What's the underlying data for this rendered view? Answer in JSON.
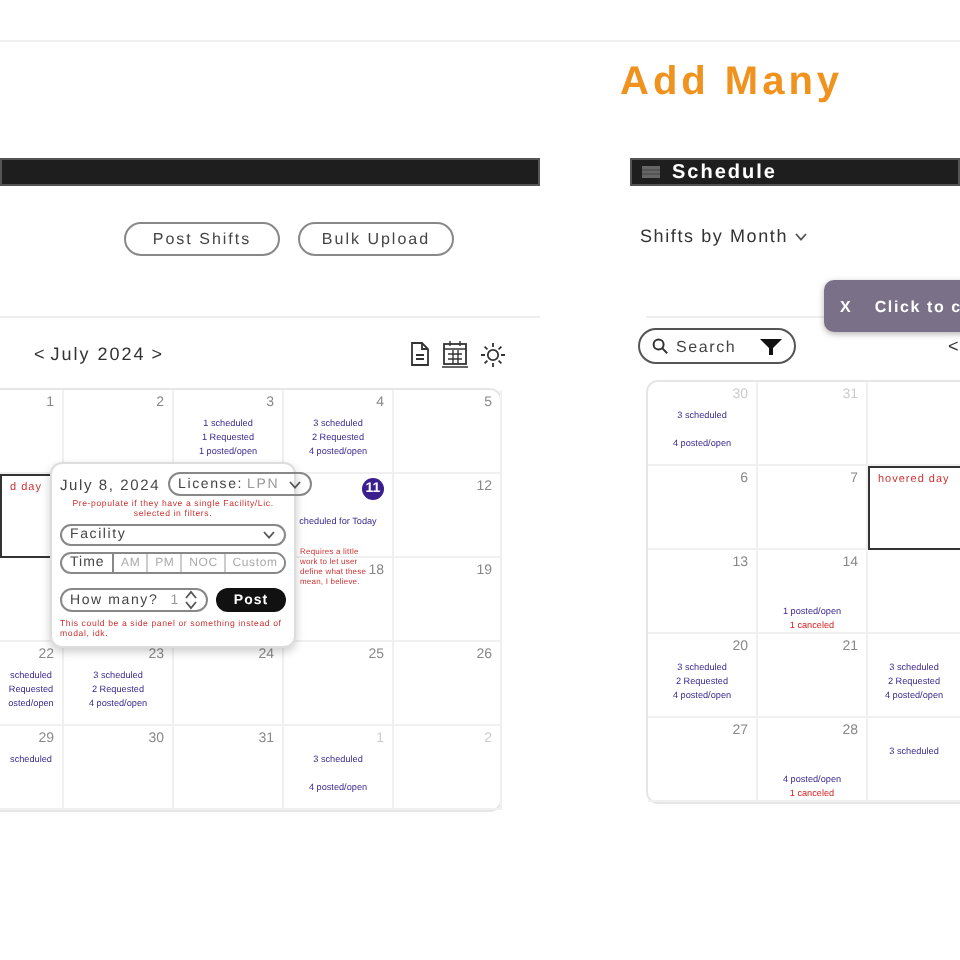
{
  "canvas_title": "Add Many",
  "left_frame": {
    "actions": [
      {
        "label": "Post Shifts"
      },
      {
        "label": "Bulk Upload"
      }
    ],
    "month_nav": {
      "prev": "<",
      "month": "July 2024",
      "next": ">"
    },
    "calendar": {
      "rows": [
        [
          {
            "day": "1",
            "kind": "current"
          },
          {
            "day": "2",
            "kind": "current"
          },
          {
            "day": "3",
            "kind": "current",
            "lines": [
              {
                "text": "1 scheduled",
                "kind": "scheduled"
              },
              {
                "text": "1 Requested",
                "kind": "requested"
              },
              {
                "text": "1 posted/open",
                "kind": "posted"
              }
            ]
          },
          {
            "day": "4",
            "kind": "current",
            "lines": [
              {
                "text": "3 scheduled",
                "kind": "scheduled"
              },
              {
                "text": "2 Requested",
                "kind": "requested"
              },
              {
                "text": "4 posted/open",
                "kind": "posted"
              }
            ]
          },
          {
            "day": "5",
            "kind": "current"
          }
        ],
        [
          {
            "kind": "hovered",
            "label": "d day"
          },
          null,
          null,
          {
            "day": "11",
            "kind": "today",
            "lines": [
              {
                "text": "cheduled for Today",
                "kind": "summary"
              }
            ]
          },
          {
            "day": "12",
            "kind": "current"
          }
        ],
        [
          null,
          null,
          null,
          {
            "day": "18",
            "kind": "current"
          },
          {
            "day": "19",
            "kind": "current"
          }
        ],
        [
          {
            "day": "22",
            "kind": "current",
            "lines": [
              {
                "text": "scheduled",
                "kind": "scheduled"
              },
              {
                "text": "Requested",
                "kind": "requested"
              },
              {
                "text": "osted/open",
                "kind": "posted"
              }
            ]
          },
          {
            "day": "23",
            "kind": "current",
            "lines": [
              {
                "text": "3 scheduled",
                "kind": "scheduled"
              },
              {
                "text": "2 Requested",
                "kind": "requested"
              },
              {
                "text": "4 posted/open",
                "kind": "posted"
              }
            ]
          },
          {
            "day": "24",
            "kind": "current"
          },
          {
            "day": "25",
            "kind": "current"
          },
          {
            "day": "26",
            "kind": "current"
          }
        ],
        [
          {
            "day": "29",
            "kind": "current",
            "lines": [
              {
                "text": "scheduled",
                "kind": "scheduled"
              }
            ]
          },
          {
            "day": "30",
            "kind": "current"
          },
          {
            "day": "31",
            "kind": "current"
          },
          {
            "day": "1",
            "kind": "other_month",
            "lines": [
              {
                "text": "3 scheduled",
                "kind": "scheduled"
              },
              {
                "text": "4 posted/open",
                "kind": "posted"
              }
            ]
          },
          {
            "day": "2",
            "kind": "other_month"
          }
        ]
      ]
    },
    "popup": {
      "date": "July 8, 2024",
      "license": {
        "label": "License:",
        "value": "LPN"
      },
      "license_note": "Pre-populate if they have a single Facility/Lic. selected in filters.",
      "facility": {
        "placeholder": "Facility"
      },
      "time": {
        "label": "Time",
        "options": [
          {
            "label": "AM",
            "selected": false
          },
          {
            "label": "PM",
            "selected": false
          },
          {
            "label": "NOC",
            "selected": false
          },
          {
            "label": "Custom",
            "selected": false
          }
        ]
      },
      "quantity": {
        "label": "How many?",
        "value": "1"
      },
      "post_button": "Post",
      "note": "This could be a side panel or something instead of modal, idk."
    },
    "side_note": "Requires a little work to let user define what these mean, I believe."
  },
  "right_frame": {
    "header": {
      "title": "Schedule"
    },
    "view_select": "Shifts by Month",
    "toast": {
      "close": "X",
      "text": "Click to c"
    },
    "search": {
      "placeholder": "Search"
    },
    "month_nav": {
      "prev": "<"
    },
    "calendar": {
      "rows": [
        [
          {
            "day": "30",
            "kind": "other_month",
            "lines": [
              {
                "text": "3 scheduled",
                "kind": "scheduled"
              },
              {
                "text": "4 posted/open",
                "kind": "posted"
              }
            ]
          },
          {
            "day": "31",
            "kind": "other_month"
          },
          null
        ],
        [
          {
            "day": "6",
            "kind": "current"
          },
          {
            "day": "7",
            "kind": "current"
          },
          {
            "kind": "hovered",
            "label": "hovered day"
          }
        ],
        [
          {
            "day": "13",
            "kind": "current"
          },
          {
            "day": "14",
            "kind": "current",
            "lines": [
              {
                "text": "1 posted/open",
                "kind": "posted"
              },
              {
                "text": "1 canceled",
                "kind": "canceled"
              }
            ]
          },
          null
        ],
        [
          {
            "day": "20",
            "kind": "current",
            "lines": [
              {
                "text": "3 scheduled",
                "kind": "scheduled"
              },
              {
                "text": "2 Requested",
                "kind": "requested"
              },
              {
                "text": "4 posted/open",
                "kind": "posted"
              }
            ]
          },
          {
            "day": "21",
            "kind": "current"
          },
          {
            "kind": "current",
            "lines": [
              {
                "text": "3 scheduled",
                "kind": "scheduled"
              },
              {
                "text": "2 Requested",
                "kind": "requested"
              },
              {
                "text": "4 posted/open",
                "kind": "posted"
              }
            ]
          }
        ],
        [
          {
            "day": "27",
            "kind": "current"
          },
          {
            "day": "28",
            "kind": "current",
            "lines": [
              {
                "text": "4 posted/open",
                "kind": "posted"
              },
              {
                "text": "1 canceled",
                "kind": "canceled"
              }
            ]
          },
          {
            "kind": "current",
            "lines": [
              {
                "text": "3 scheduled",
                "kind": "scheduled"
              }
            ]
          }
        ]
      ]
    }
  }
}
